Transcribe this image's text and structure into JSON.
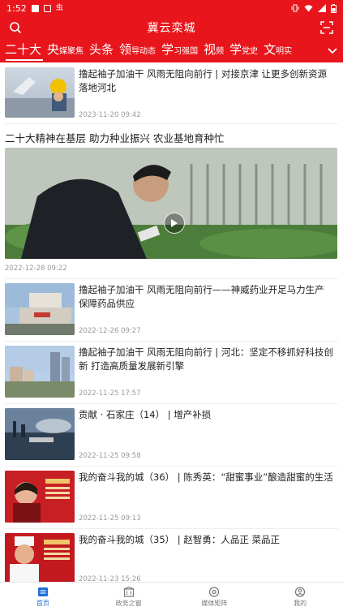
{
  "status_bar": {
    "time": "1:52",
    "notif_glyph": "虫"
  },
  "header": {
    "title": "冀云栾城"
  },
  "tabs": [
    {
      "big": "二十大",
      "small": ""
    },
    {
      "big": "央",
      "small": "媒聚焦"
    },
    {
      "big": "头条",
      "small": ""
    },
    {
      "big": "领",
      "small": "导动态"
    },
    {
      "big": "学",
      "small": "习强国"
    },
    {
      "big": "视",
      "small": "频"
    },
    {
      "big": "学",
      "small": "党史"
    },
    {
      "big": "文",
      "small": "明实"
    }
  ],
  "feed": {
    "item0": {
      "title": "撸起袖子加油干 风雨无阻向前行 | 对接京津 让更多创新资源落地河北",
      "time": "2023-11-20 09:42"
    },
    "video": {
      "title": "二十大精神在基层 助力种业振兴 农业基地育种忙",
      "time": "2022-12-28 09:22"
    },
    "item1": {
      "title": "撸起袖子加油干 风雨无阻向前行——神威药业开足马力生产 保障药品供应",
      "time": "2022-12-26 09:27"
    },
    "item2": {
      "title": "撸起袖子加油干 风雨无阻向前行 | 河北：坚定不移抓好科技创新 打造高质量发展新引擎",
      "time": "2022-11-25 17:57"
    },
    "item3": {
      "title": "贡献 · 石家庄（14） | 增产补损",
      "time": "2022-11-25 09:58"
    },
    "item4": {
      "title": "我的奋斗我的城（36） | 陈秀英：“甜蜜事业”酿造甜蜜的生活",
      "time": "2022-11-25 09:13"
    },
    "item5": {
      "title": "我的奋斗我的城（35） | 赵智勇：人品正 菜品正",
      "time": "2022-11-23 15:26"
    }
  },
  "bottom_nav": [
    {
      "label": "首页",
      "icon": "home-icon",
      "active": true
    },
    {
      "label": "政务之窗",
      "icon": "government-icon",
      "active": false
    },
    {
      "label": "媒体矩阵",
      "icon": "matrix-icon",
      "active": false
    },
    {
      "label": "我的",
      "icon": "profile-icon",
      "active": false
    }
  ],
  "colors": {
    "brand_red": "#e8161c",
    "active_blue": "#1e6fd9",
    "time_gray": "#9a9a9a"
  }
}
